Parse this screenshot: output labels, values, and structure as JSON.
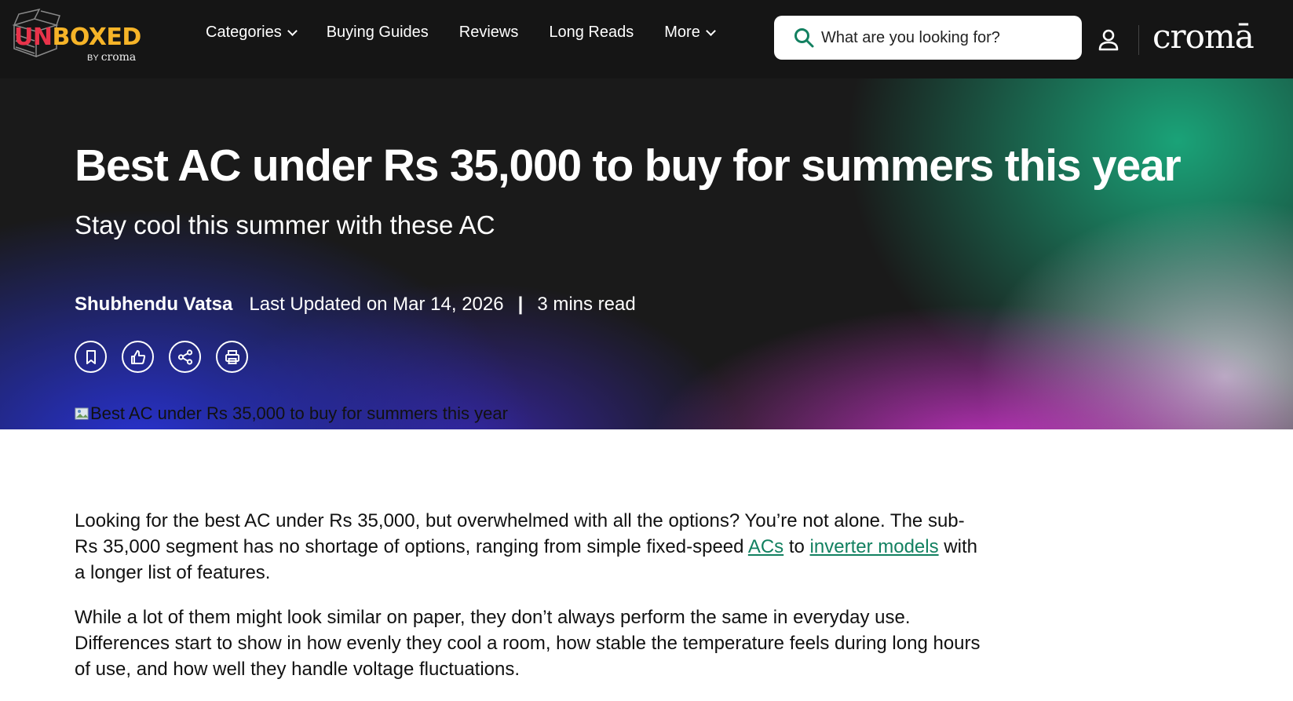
{
  "brand": {
    "logo_part1": "UN",
    "logo_part2": "BOXED",
    "logo_by": "BY",
    "logo_by_brand": "croma",
    "partner": "cromā",
    "colors": {
      "red": "#e8334a",
      "yellow": "#f6b428",
      "link": "#128060"
    }
  },
  "nav": {
    "items": [
      {
        "label": "Categories",
        "has_dropdown": true
      },
      {
        "label": "Buying Guides",
        "has_dropdown": false
      },
      {
        "label": "Reviews",
        "has_dropdown": false
      },
      {
        "label": "Long Reads",
        "has_dropdown": false
      },
      {
        "label": "More",
        "has_dropdown": true
      }
    ]
  },
  "search": {
    "placeholder": "What are you looking for?",
    "icon": "search-icon"
  },
  "header_icons": [
    "user-icon"
  ],
  "article": {
    "title": "Best AC under Rs 35,000 to buy for summers this year",
    "subtitle": "Stay cool this summer with these AC",
    "author": "Shubhendu Vatsa",
    "updated": "Last Updated on Mar 14, 2026",
    "separator": "|",
    "read_time": "3 mins read",
    "actions": [
      "bookmark-icon",
      "like-icon",
      "share-icon",
      "print-icon"
    ],
    "hero_image_alt": "Best AC under Rs 35,000 to buy for summers this year",
    "p1": {
      "text1": "Looking for the best AC under Rs 35,000, but overwhelmed with all the options? You’re not alone. The sub-Rs 35,000 segment has no shortage of options, ranging from simple fixed-speed ",
      "link1": "ACs",
      "text2": " to ",
      "link2": "inverter models",
      "text3": " with a longer list of features."
    },
    "p2": "While a lot of them might look similar on paper, they don’t always perform the same in everyday use. Differences start to show in how evenly they cool a room, how stable the temperature feels during long hours of use, and how well they handle voltage fluctuations."
  }
}
